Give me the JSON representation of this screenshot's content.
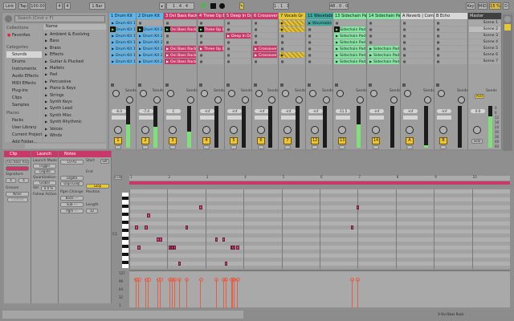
{
  "transport": {
    "link": "Link",
    "tap": "Tap",
    "tempo": "100.00",
    "sig_num": "4",
    "sig_den": "4",
    "quant": "1 Bar",
    "position": "1 . 4 . 4",
    "loop_start": "1 . 1 . 1",
    "loop_len": "48 . 0 . 0",
    "key": "Key",
    "midi": "MIDI",
    "cpu": "15 %",
    "d": "D"
  },
  "browser": {
    "search_placeholder": "Search (Cmd + F)",
    "collections_label": "Collections",
    "favorites": "Favorites",
    "categories_label": "Categories",
    "categories": [
      "Sounds",
      "Drums",
      "Instruments",
      "Audio Effects",
      "MIDI Effects",
      "Plug-ins",
      "Clips",
      "Samples"
    ],
    "places_label": "Places",
    "places": [
      "Packs",
      "User Library",
      "Current Project",
      "Add Folder..."
    ],
    "name_header": "Name",
    "items": [
      "Ambient & Evolving",
      "Bass",
      "Brass",
      "Effects",
      "Guitar & Plucked",
      "Mallets",
      "Pad",
      "Percussive",
      "Piano & Keys",
      "Strings",
      "Synth Keys",
      "Synth Lead",
      "Synth Misc",
      "Synth Rhythmic",
      "Voices",
      "Winds"
    ]
  },
  "tracks": [
    {
      "name": "1 Drum Kit",
      "color": "#5fb4ea",
      "clips": [
        "Drum Kit 1",
        "Drum Kit 1",
        "Drum Kit 1",
        "Drum Kit 1",
        "Drum Kit 1",
        "Drum Kit 1",
        "Drum Kit 1"
      ],
      "playing": 1,
      "number": "1",
      "vol": "-6.0",
      "meter": 0.55
    },
    {
      "name": "2 Drum Kit",
      "color": "#5fb4ea",
      "clips": [
        null,
        "Drum Kit 2",
        "Drum Kit 2",
        "Drum Kit 2",
        "Drum Kit 2",
        "Drum Kit 2",
        "Drum Kit 2"
      ],
      "playing": 1,
      "number": "2",
      "vol": "-7.4",
      "meter": 0.5
    },
    {
      "name": "3 Ovi Bass Rack",
      "color": "#c8396a",
      "clips": [
        null,
        "Ovi Bass Rack",
        null,
        null,
        "Ovi Bass Rack",
        "Ovi Bass Rack",
        "Ovi Bass Rack"
      ],
      "playing": 1,
      "number": "3",
      "vol": "C",
      "meter": 0.38
    },
    {
      "name": "4 Three Op Ba",
      "color": "#c8396a",
      "clips": [
        null,
        "Three Op Ba",
        null,
        null,
        "Three Op Ba",
        null,
        null
      ],
      "playing": 1,
      "number": "4",
      "vol": "-inf",
      "meter": 0
    },
    {
      "name": "5 Deep In Dark",
      "color": "#c8396a",
      "clips": [
        null,
        null,
        "Deep In Dark",
        null,
        null,
        null,
        null
      ],
      "playing": -1,
      "number": "5",
      "vol": "-inf",
      "meter": 0
    },
    {
      "name": "6 Crossover Sy",
      "color": "#c8396a",
      "clips": [
        null,
        null,
        null,
        null,
        "Crossover S",
        "Crossover S",
        null
      ],
      "playing": -1,
      "number": "6",
      "vol": "-inf",
      "meter": 0
    },
    {
      "name": "7 Vocals Gr",
      "color": "#e6c737",
      "clips": [
        "",
        "",
        null,
        null,
        null,
        "",
        null
      ],
      "playing": -1,
      "number": "7",
      "vol": "-inf",
      "meter": 0
    },
    {
      "name": "11 Wavetable",
      "color": "#3fa79d",
      "clips": [
        "Wavetable",
        null,
        null,
        null,
        null,
        null,
        null
      ],
      "playing": -1,
      "number": "12",
      "vol": "-inf",
      "meter": 0
    },
    {
      "name": "13 Sidechain Pad",
      "color": "#86e6a4",
      "clips": [
        null,
        "Sidechain Pad",
        "Sidechain Pad",
        "Sidechain Pad",
        "Sidechain Pad",
        "Sidechain Pad",
        "Sidechain Pad"
      ],
      "playing": 1,
      "number": "13",
      "vol": "-11.5",
      "meter": 0.55
    },
    {
      "name": "14 Sidechain Pad",
      "color": "#86e6a4",
      "clips": [
        null,
        null,
        null,
        null,
        "Sidechain Pad",
        "Sidechain Pad",
        "Sidechain Pad"
      ],
      "playing": -1,
      "number": "14",
      "vol": "-inf",
      "meter": 0
    },
    {
      "name": "A Reverb | Compre",
      "color": "#d8d8d8",
      "clips": [
        null,
        null,
        null,
        null,
        null,
        null,
        null
      ],
      "playing": -1,
      "number": "A",
      "vol": "-inf",
      "meter": 0.05
    },
    {
      "name": "B Echo",
      "color": "#d8d8d8",
      "clips": [
        null,
        null,
        null,
        null,
        null,
        null,
        null
      ],
      "playing": -1,
      "number": "B",
      "vol": "-inf",
      "meter": 0
    }
  ],
  "master": {
    "name": "Master",
    "scenes": [
      "Scene 1",
      "Scene 2",
      "Scene 3",
      "Scene 4",
      "Scene 5",
      "Scene 6",
      "Scene 7"
    ],
    "sends_label": "Sends",
    "post": "Post",
    "solo": "Solo",
    "vol": "0.0",
    "meter": 0.75
  },
  "sends_label": "Sends",
  "meter_scale": [
    "0",
    "6",
    "12",
    "18",
    "24",
    "30",
    "36",
    "48",
    "60"
  ],
  "clip_panel": {
    "title": "Clip",
    "name": "Ovi Bass Rack",
    "signature_label": "Signature",
    "sig_num": "4",
    "sig_den": "4",
    "groove_label": "Groove",
    "groove": "None",
    "commit": "Commit"
  },
  "launch_panel": {
    "title": "Launch",
    "mode_label": "Launch Mode",
    "mode": "Trigger",
    "legato": "Legato",
    "quant_label": "Quantization",
    "quant": "Global",
    "vel_label": "Vel",
    "vel": "0.0 %",
    "follow_label": "Follow Action"
  },
  "notes_panel": {
    "title": "Notes",
    "range": "C0-A1",
    "legato": "Legato",
    "dupe": "Dupl.Loop",
    "start_label": "Start",
    "end_label": "End",
    "set": "Set",
    "loop": "Loop",
    "position_label": "Position",
    "length_label": "Length",
    "pgm_label": "Pgm Change",
    "bank": "Bank ---",
    "sub": "Sub ---",
    "pgm": "Pgm ---",
    "length": "32"
  },
  "roll": {
    "fold": "Fold",
    "bars": [
      "1",
      "2",
      "3",
      "4",
      "5",
      "6",
      "7",
      "8",
      "9",
      "10"
    ],
    "c1": "C1",
    "vel_ticks": [
      "127",
      "96",
      "64",
      "32",
      "1"
    ],
    "notes": [
      [
        2.2,
        5
      ],
      [
        2.4,
        5
      ],
      [
        6.5,
        5
      ],
      [
        3.5,
        10
      ],
      [
        7.5,
        2
      ],
      [
        23.5,
        5
      ],
      [
        29.5,
        0
      ],
      [
        11.5,
        8
      ],
      [
        12.5,
        8
      ],
      [
        16.5,
        10
      ],
      [
        17.5,
        10
      ],
      [
        18.5,
        10
      ],
      [
        20.5,
        14
      ],
      [
        36,
        8
      ],
      [
        39,
        8
      ],
      [
        42.5,
        10
      ],
      [
        43,
        10
      ],
      [
        43.5,
        10
      ],
      [
        45,
        10
      ],
      [
        40,
        14
      ],
      [
        93,
        5
      ],
      [
        95.5,
        0
      ]
    ]
  },
  "status": {
    "clip": "3-Ovi Bass Rack"
  }
}
